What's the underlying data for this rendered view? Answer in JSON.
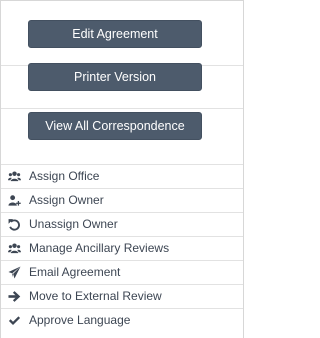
{
  "actions": {
    "buttons": [
      {
        "label": "Edit Agreement"
      },
      {
        "label": "Printer Version"
      },
      {
        "label": "View All Correspondence"
      }
    ],
    "menu": [
      {
        "label": "Assign Office",
        "icon": "users-icon"
      },
      {
        "label": "Assign Owner",
        "icon": "user-plus-icon"
      },
      {
        "label": "Unassign Owner",
        "icon": "undo-icon"
      },
      {
        "label": "Manage Ancillary Reviews",
        "icon": "users-icon"
      },
      {
        "label": "Email Agreement",
        "icon": "paper-plane-icon"
      },
      {
        "label": "Move to External Review",
        "icon": "arrow-right-icon"
      },
      {
        "label": "Approve Language",
        "icon": "check-icon"
      }
    ]
  },
  "colors": {
    "button_bg": "#4d5b6c",
    "button_text": "#ffffff",
    "menu_text": "#3d4653",
    "icon": "#3d4653",
    "divider": "#e2e2e2"
  }
}
